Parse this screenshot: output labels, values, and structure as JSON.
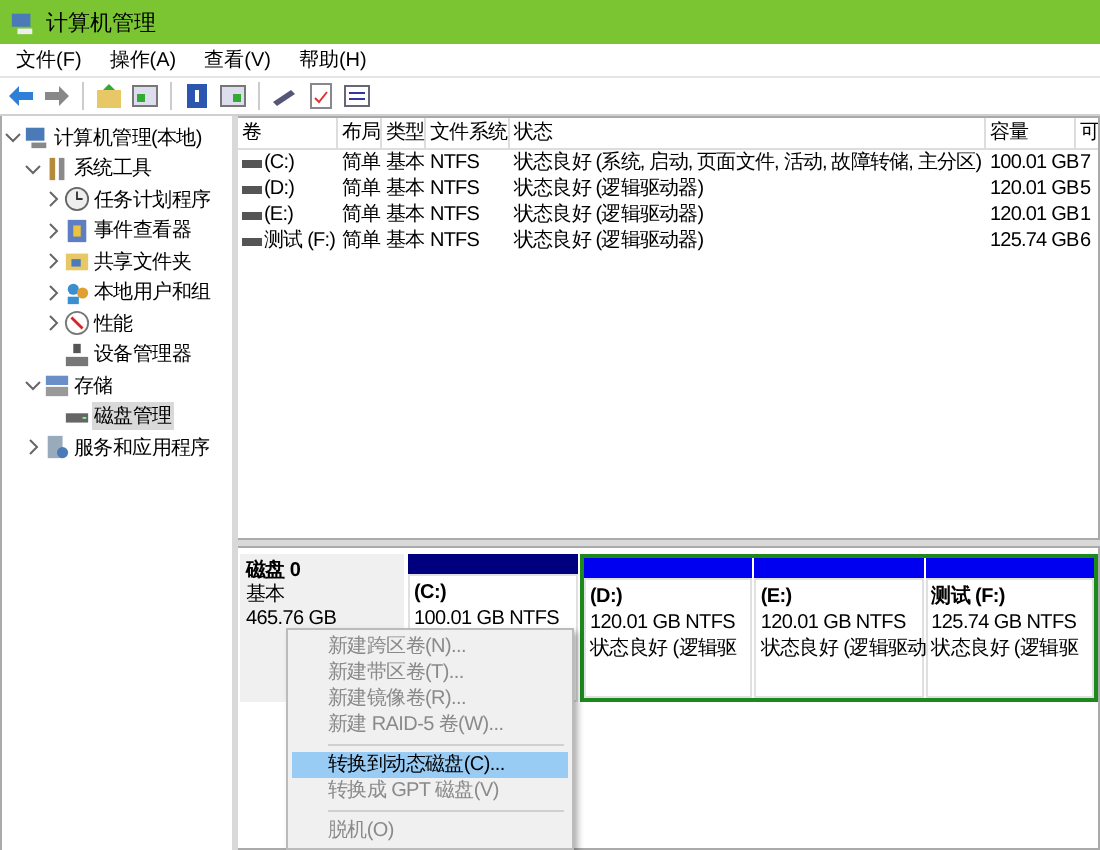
{
  "window": {
    "title": "计算机管理"
  },
  "menu": [
    "文件(F)",
    "操作(A)",
    "查看(V)",
    "帮助(H)"
  ],
  "tree": [
    {
      "label": "计算机管理(本地)",
      "expanded": true,
      "selected": false,
      "children": [
        {
          "label": "系统工具",
          "expanded": true,
          "selected": false,
          "children": [
            {
              "label": "任务计划程序",
              "expanded": false,
              "selected": false
            },
            {
              "label": "事件查看器",
              "expanded": false,
              "selected": false
            },
            {
              "label": "共享文件夹",
              "expanded": false,
              "selected": false
            },
            {
              "label": "本地用户和组",
              "expanded": false,
              "selected": false
            },
            {
              "label": "性能",
              "expanded": false,
              "selected": false
            },
            {
              "label": "设备管理器",
              "selected": false
            }
          ]
        },
        {
          "label": "存储",
          "expanded": true,
          "selected": false,
          "children": [
            {
              "label": "磁盘管理",
              "selected": true
            }
          ]
        },
        {
          "label": "服务和应用程序",
          "expanded": false,
          "selected": false
        }
      ]
    }
  ],
  "table": {
    "columns": [
      "卷",
      "布局",
      "类型",
      "文件系统",
      "状态",
      "容量",
      "可"
    ],
    "rows": [
      [
        "(C:)",
        "简单",
        "基本",
        "NTFS",
        "状态良好 (系统, 启动, 页面文件, 活动, 故障转储, 主分区)",
        "100.01 GB",
        "7"
      ],
      [
        "(D:)",
        "简单",
        "基本",
        "NTFS",
        "状态良好 (逻辑驱动器)",
        "120.01 GB",
        "5"
      ],
      [
        "(E:)",
        "简单",
        "基本",
        "NTFS",
        "状态良好 (逻辑驱动器)",
        "120.01 GB",
        "1"
      ],
      [
        "测试 (F:)",
        "简单",
        "基本",
        "NTFS",
        "状态良好 (逻辑驱动器)",
        "125.74 GB",
        "6"
      ]
    ]
  },
  "disk": {
    "name": "磁盘 0",
    "type": "基本",
    "size": "465.76 GB",
    "partitions": [
      {
        "kind": "primary",
        "name": "(C:)",
        "size": "100.01 GB NTFS"
      },
      {
        "kind": "logical",
        "name": "(D:)",
        "size": "120.01 GB NTFS",
        "status": "状态良好 (逻辑驱"
      },
      {
        "kind": "logical",
        "name": "(E:)",
        "size": "120.01 GB NTFS",
        "status": "状态良好 (逻辑驱动"
      },
      {
        "kind": "logical",
        "name": "测试 (F:)",
        "size": "125.74 GB NTFS",
        "status": "状态良好 (逻辑驱"
      }
    ]
  },
  "context_menu": [
    {
      "kind": "item",
      "label": "新建跨区卷(N)...",
      "disabled": true,
      "selected": false
    },
    {
      "kind": "item",
      "label": "新建带区卷(T)...",
      "disabled": true,
      "selected": false
    },
    {
      "kind": "item",
      "label": "新建镜像卷(R)...",
      "disabled": true,
      "selected": false
    },
    {
      "kind": "item",
      "label": "新建 RAID-5 卷(W)...",
      "disabled": true,
      "selected": false
    },
    {
      "kind": "separator"
    },
    {
      "kind": "item",
      "label": "转换到动态磁盘(C)...",
      "disabled": false,
      "selected": true
    },
    {
      "kind": "item",
      "label": "转换成 GPT 磁盘(V)",
      "disabled": true,
      "selected": false
    },
    {
      "kind": "separator"
    },
    {
      "kind": "item",
      "label": "脱机(O)",
      "disabled": true,
      "selected": false
    }
  ]
}
